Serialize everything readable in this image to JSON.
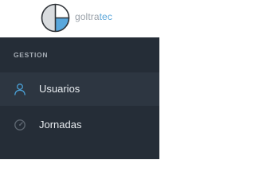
{
  "brand": {
    "name_main": "goltra",
    "name_accent": "tec",
    "logo_icon": "logo-pie-icon",
    "colors": {
      "accent": "#5aa6da",
      "text": "#9aa1a9"
    }
  },
  "sidebar": {
    "section_header": "GESTION",
    "items": [
      {
        "label": "Usuarios",
        "icon": "user-icon",
        "active": true
      },
      {
        "label": "Jornadas",
        "icon": "gauge-icon",
        "active": false
      }
    ],
    "colors": {
      "background": "#252d37",
      "active_background": "#2d3641",
      "icon_accent": "#4aa0d6"
    }
  }
}
